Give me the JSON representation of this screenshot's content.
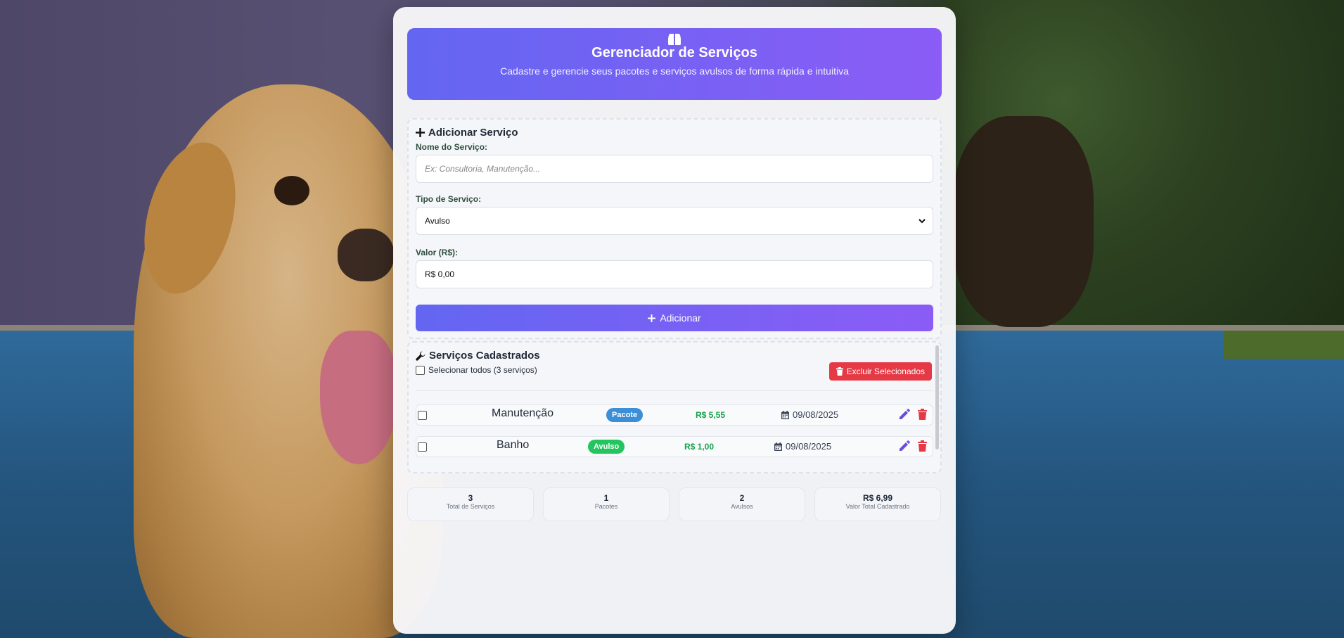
{
  "colors": {
    "accent_start": "#6366f1",
    "accent_end": "#8b5cf6",
    "danger": "#e53945",
    "success_text": "#16a34a",
    "badge_pacote": "#3b8fd6",
    "badge_avulso": "#22c55e"
  },
  "header": {
    "icon": "box-icon",
    "title": "Gerenciador de Serviços",
    "subtitle": "Cadastre e gerencie seus pacotes e serviços avulsos de forma rápida e intuitiva"
  },
  "add_form": {
    "title": "Adicionar Serviço",
    "name_label": "Nome do Serviço:",
    "name_placeholder": "Ex: Consultoria, Manutenção...",
    "name_value": "",
    "type_label": "Tipo de Serviço:",
    "type_value": "Avulso",
    "value_label": "Valor (R$):",
    "value_value": "R$ 0,00",
    "submit_label": "Adicionar"
  },
  "list": {
    "title": "Serviços Cadastrados",
    "select_all_label": "Selecionar todos (3 serviços)",
    "delete_selected_label": "Excluir Selecionados",
    "items": [
      {
        "name": "Manutenção",
        "type": "Pacote",
        "price": "R$ 5,55",
        "date": "09/08/2025"
      },
      {
        "name": "Banho",
        "type": "Avulso",
        "price": "R$ 1,00",
        "date": "09/08/2025"
      }
    ]
  },
  "stats": [
    {
      "value": "3",
      "label": "Total de Serviços"
    },
    {
      "value": "1",
      "label": "Pacotes"
    },
    {
      "value": "2",
      "label": "Avulsos"
    },
    {
      "value": "R$ 6,99",
      "label": "Valor Total Cadastrado"
    }
  ]
}
